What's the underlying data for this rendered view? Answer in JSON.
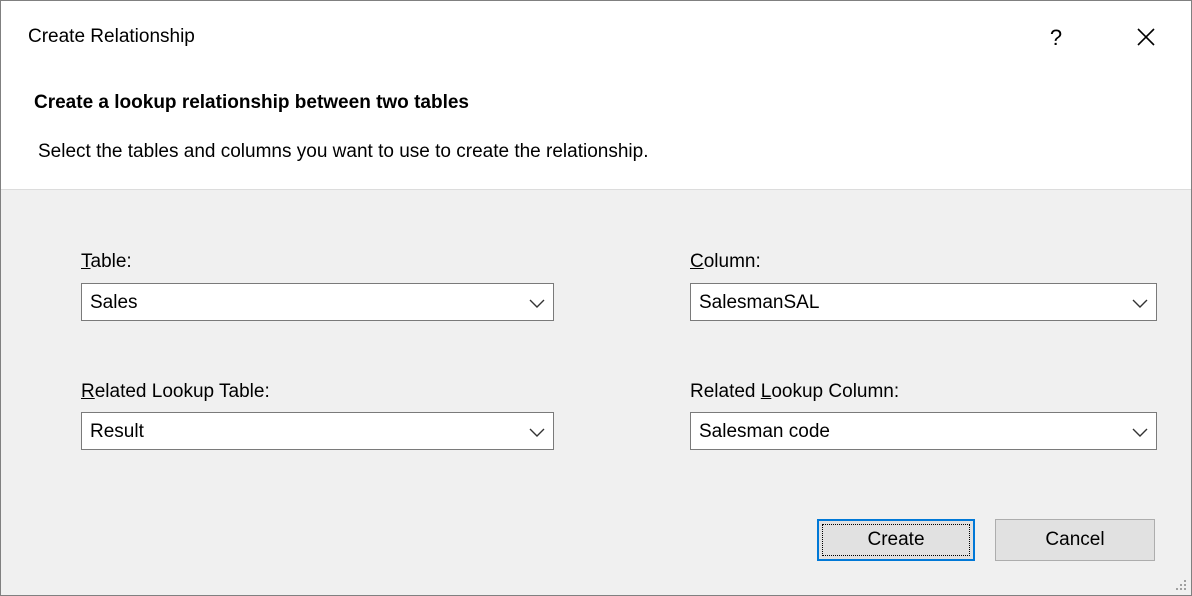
{
  "window": {
    "title": "Create Relationship",
    "help_label": "?",
    "close_icon": "close-icon"
  },
  "header": {
    "heading": "Create a lookup relationship between two tables",
    "description": "Select the tables and columns you want to use to create the relationship."
  },
  "fields": {
    "table": {
      "mnemonic": "T",
      "label_rest": "able:",
      "value": "Sales"
    },
    "column": {
      "mnemonic": "C",
      "label_rest": "olumn:",
      "value": "SalesmanSAL"
    },
    "related_table": {
      "mnemonic": "R",
      "label_rest": "elated Lookup Table:",
      "value": "Result"
    },
    "related_column": {
      "label_pre": "Related ",
      "mnemonic": "L",
      "label_rest": "ookup Column:",
      "value": "Salesman code"
    }
  },
  "buttons": {
    "create": "Create",
    "cancel": "Cancel"
  },
  "colors": {
    "accent": "#0078d7",
    "dialog_bg": "#f0f0f0"
  }
}
